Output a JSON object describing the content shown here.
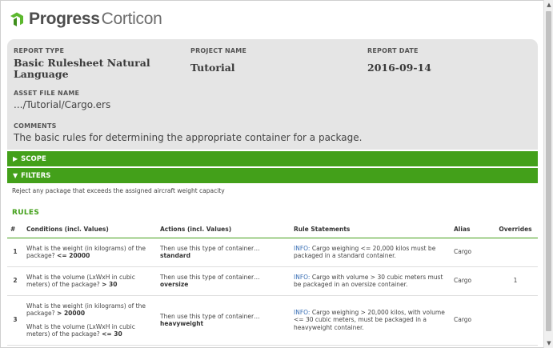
{
  "brand": {
    "name": "Progress",
    "product": "Corticon"
  },
  "report": {
    "type_label": "REPORT TYPE",
    "type_value": "Basic Rulesheet Natural Language",
    "project_label": "PROJECT NAME",
    "project_value": "Tutorial",
    "date_label": "REPORT DATE",
    "date_value": "2016-09-14",
    "asset_label": "ASSET FILE NAME",
    "asset_value": ".../Tutorial/Cargo.ers",
    "comments_label": "COMMENTS",
    "comments_value": "The basic rules for determining the appropriate container for a package."
  },
  "sections": {
    "scope_label": "SCOPE",
    "filters_label": "FILTERS",
    "filter_text": "Reject any package that exceeds the assigned aircraft weight capacity",
    "rules_label": "RULES"
  },
  "table": {
    "headers": {
      "num": "#",
      "conditions": "Conditions (incl. Values)",
      "actions": "Actions (incl. Values)",
      "statements": "Rule Statements",
      "alias": "Alias",
      "overrides": "Overrides"
    },
    "rows": [
      {
        "num": "1",
        "cond1_text": "What is the weight (in kilograms) of the package?",
        "cond1_value": "<= 20000",
        "cond2_text": "",
        "cond2_value": "",
        "action_text": "Then use this type of container…",
        "action_value": "standard",
        "info_tag": "INFO:",
        "statement": "Cargo weighing <= 20,000 kilos must be packaged in a standard container.",
        "alias": "Cargo",
        "overrides": ""
      },
      {
        "num": "2",
        "cond1_text": "What is the volume (LxWxH in cubic meters) of the package?",
        "cond1_value": "> 30",
        "cond2_text": "",
        "cond2_value": "",
        "action_text": "Then use this type of container…",
        "action_value": "oversize",
        "info_tag": "INFO:",
        "statement": "Cargo with volume > 30 cubic meters must be packaged in an oversize container.",
        "alias": "Cargo",
        "overrides": "1"
      },
      {
        "num": "3",
        "cond1_text": "What is the weight (in kilograms) of the package?",
        "cond1_value": "> 20000",
        "cond2_text": "What is the volume (LxWxH in cubic meters) of the package?",
        "cond2_value": "<= 30",
        "action_text": "Then use this type of container…",
        "action_value": "heavyweight",
        "info_tag": "INFO:",
        "statement": "Cargo weighing > 20,000 kilos, with volume <= 30 cubic meters, must be packaged in a heavyweight container.",
        "alias": "Cargo",
        "overrides": ""
      }
    ]
  },
  "colors": {
    "accent": "#43a01a",
    "panel": "#e5e5e5",
    "info": "#3a6fb5"
  },
  "icons": {
    "logo": "progress-logo-icon",
    "expand": "triangle-right-icon",
    "collapse": "triangle-down-icon"
  }
}
